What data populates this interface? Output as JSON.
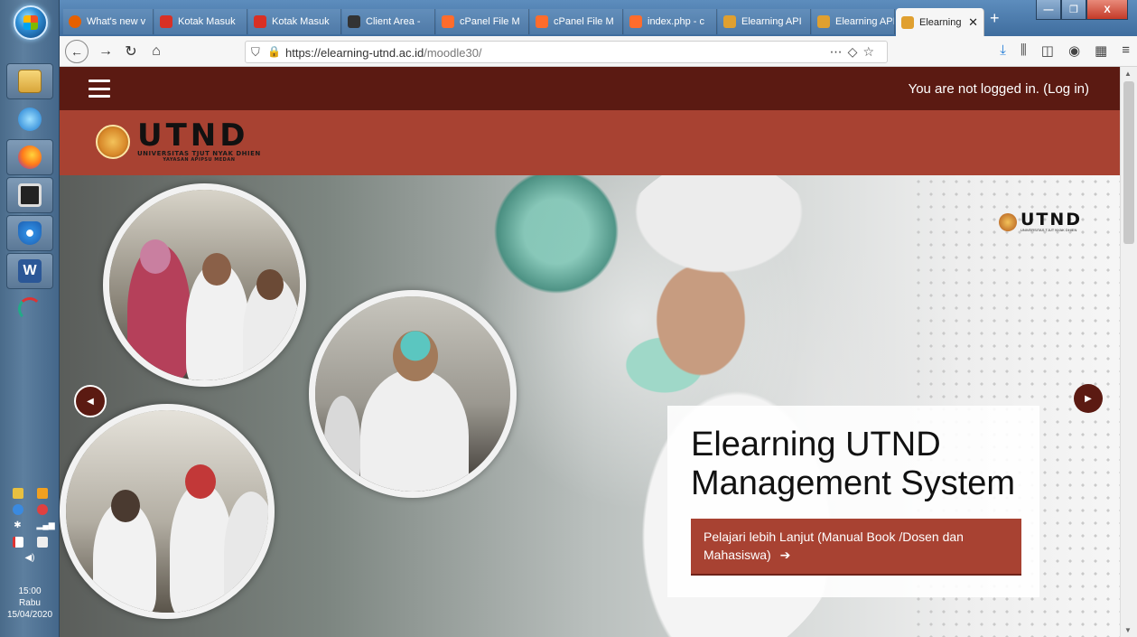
{
  "browser": {
    "tabs": [
      {
        "label": "What's new v",
        "favicon_color": "#e66000"
      },
      {
        "label": "Kotak Masuk",
        "favicon_color": "#d93025"
      },
      {
        "label": "Kotak Masuk",
        "favicon_color": "#d93025"
      },
      {
        "label": "Client Area -",
        "favicon_color": "#333333"
      },
      {
        "label": "cPanel File M",
        "favicon_color": "#ff6c2c"
      },
      {
        "label": "cPanel File M",
        "favicon_color": "#ff6c2c"
      },
      {
        "label": "index.php - c",
        "favicon_color": "#ff6c2c"
      },
      {
        "label": "Elearning API",
        "favicon_color": "#e0a030"
      },
      {
        "label": "Elearning API",
        "favicon_color": "#e0a030"
      },
      {
        "label": "Elearning",
        "favicon_color": "#e0a030",
        "active": true
      }
    ],
    "close_glyph": "✕",
    "newtab_glyph": "+",
    "url_host": "https://elearning-utnd.ac.id",
    "url_path": "/moodle30/",
    "window_controls": [
      "—",
      "❐",
      "X"
    ]
  },
  "taskbar": {
    "clock_time": "15:00",
    "clock_day": "Rabu",
    "clock_date": "15/04/2020",
    "pinned_icons": [
      "explorer-icon",
      "internet-explorer-icon",
      "firefox-icon",
      "app-icon",
      "security-shield-icon",
      "word-icon",
      "app-curve-icon"
    ]
  },
  "moodle": {
    "login_status": "You are not logged in. (Log in)",
    "logo_text": "UTND",
    "logo_subtitle": "UNIVERSITAS TJUT NYAK DHIEN",
    "logo_tagline": "YAYASAN APIPSU MEDAN",
    "hero_logo_text": "UTND",
    "hero_logo_sub": "UNIVERSITAS TJUT NYAK DHIEN",
    "hero_title": "Elearning UTND Management System",
    "cta_label": "Pelajari lebih Lanjut (Manual Book /Dosen dan Mahasiswa)",
    "cta_arrow": "➔",
    "prev_glyph": "◀",
    "next_glyph": "▶"
  },
  "colors": {
    "header_dark": "#5b1a12",
    "brand_red": "#a84232"
  }
}
